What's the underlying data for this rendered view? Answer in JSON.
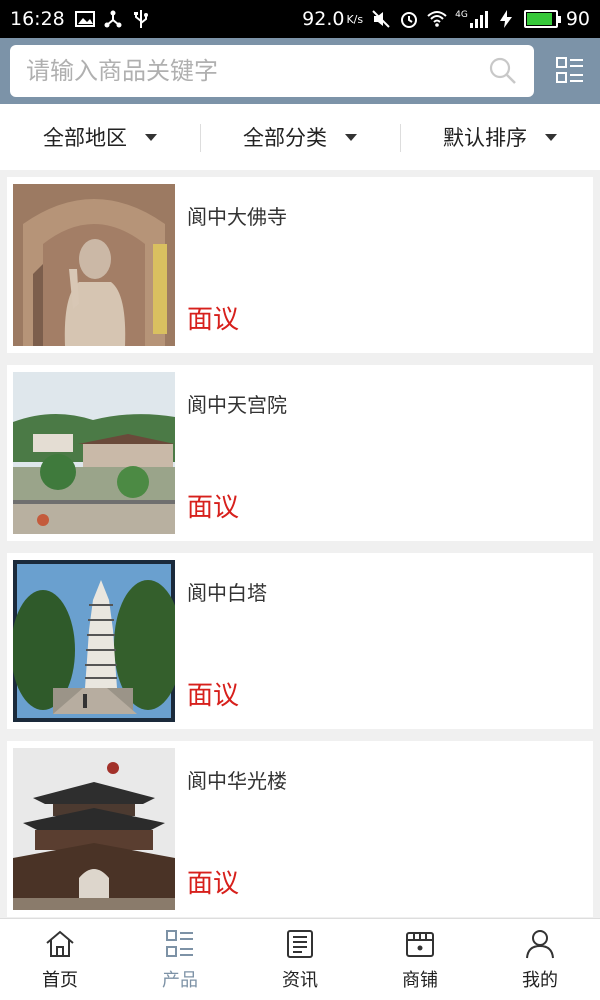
{
  "status": {
    "time": "16:28",
    "speed": "92.0",
    "speed_unit": "K/s",
    "signal_label": "4G",
    "battery_level": 0.9,
    "battery_text": "90"
  },
  "search": {
    "placeholder": "请输入商品关键字"
  },
  "filters": [
    {
      "label": "全部地区"
    },
    {
      "label": "全部分类"
    },
    {
      "label": "默认排序"
    }
  ],
  "products": [
    {
      "title": "阆中大佛寺",
      "price": "面议",
      "image": "buddha-statue"
    },
    {
      "title": "阆中天宫院",
      "price": "面议",
      "image": "temple-town"
    },
    {
      "title": "阆中白塔",
      "price": "面议",
      "image": "white-pagoda"
    },
    {
      "title": "阆中华光楼",
      "price": "面议",
      "image": "huaguang-tower"
    }
  ],
  "nav": [
    {
      "label": "首页",
      "icon": "home-icon",
      "active": false
    },
    {
      "label": "产品",
      "icon": "list-icon",
      "active": true
    },
    {
      "label": "资讯",
      "icon": "news-icon",
      "active": false
    },
    {
      "label": "商铺",
      "icon": "shop-icon",
      "active": false
    },
    {
      "label": "我的",
      "icon": "user-icon",
      "active": false
    }
  ]
}
